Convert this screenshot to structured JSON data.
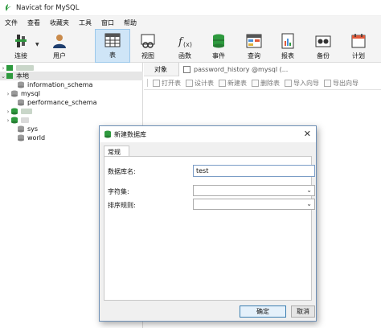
{
  "window": {
    "title": "Navicat for MySQL"
  },
  "menu": [
    "文件",
    "查看",
    "收藏夹",
    "工具",
    "窗口",
    "帮助"
  ],
  "toolbar": {
    "connect": "连接",
    "user": "用户",
    "table": "表",
    "view": "视图",
    "function": "函数",
    "event": "事件",
    "query": "查询",
    "report": "报表",
    "backup": "备份",
    "schedule": "计划"
  },
  "tree": {
    "local": "本地",
    "databases": [
      "information_schema",
      "mysql",
      "performance_schema",
      "sys",
      "world"
    ]
  },
  "object_tabs": {
    "objects": "对象",
    "open_tab": "password_history @mysql (..."
  },
  "actions": [
    "打开表",
    "设计表",
    "新建表",
    "删除表",
    "导入向导",
    "导出向导"
  ],
  "dialog": {
    "title": "新建数据库",
    "tab": "常规",
    "db_name_label": "数据库名:",
    "db_name_value": "test",
    "charset_label": "字符集:",
    "collation_label": "排序规则:",
    "ok": "确定",
    "cancel": "取消"
  },
  "colors": {
    "accent_green": "#2e9a3e",
    "active_toolbar": "#cfe5f7",
    "dialog_border": "#6d8fb5"
  }
}
